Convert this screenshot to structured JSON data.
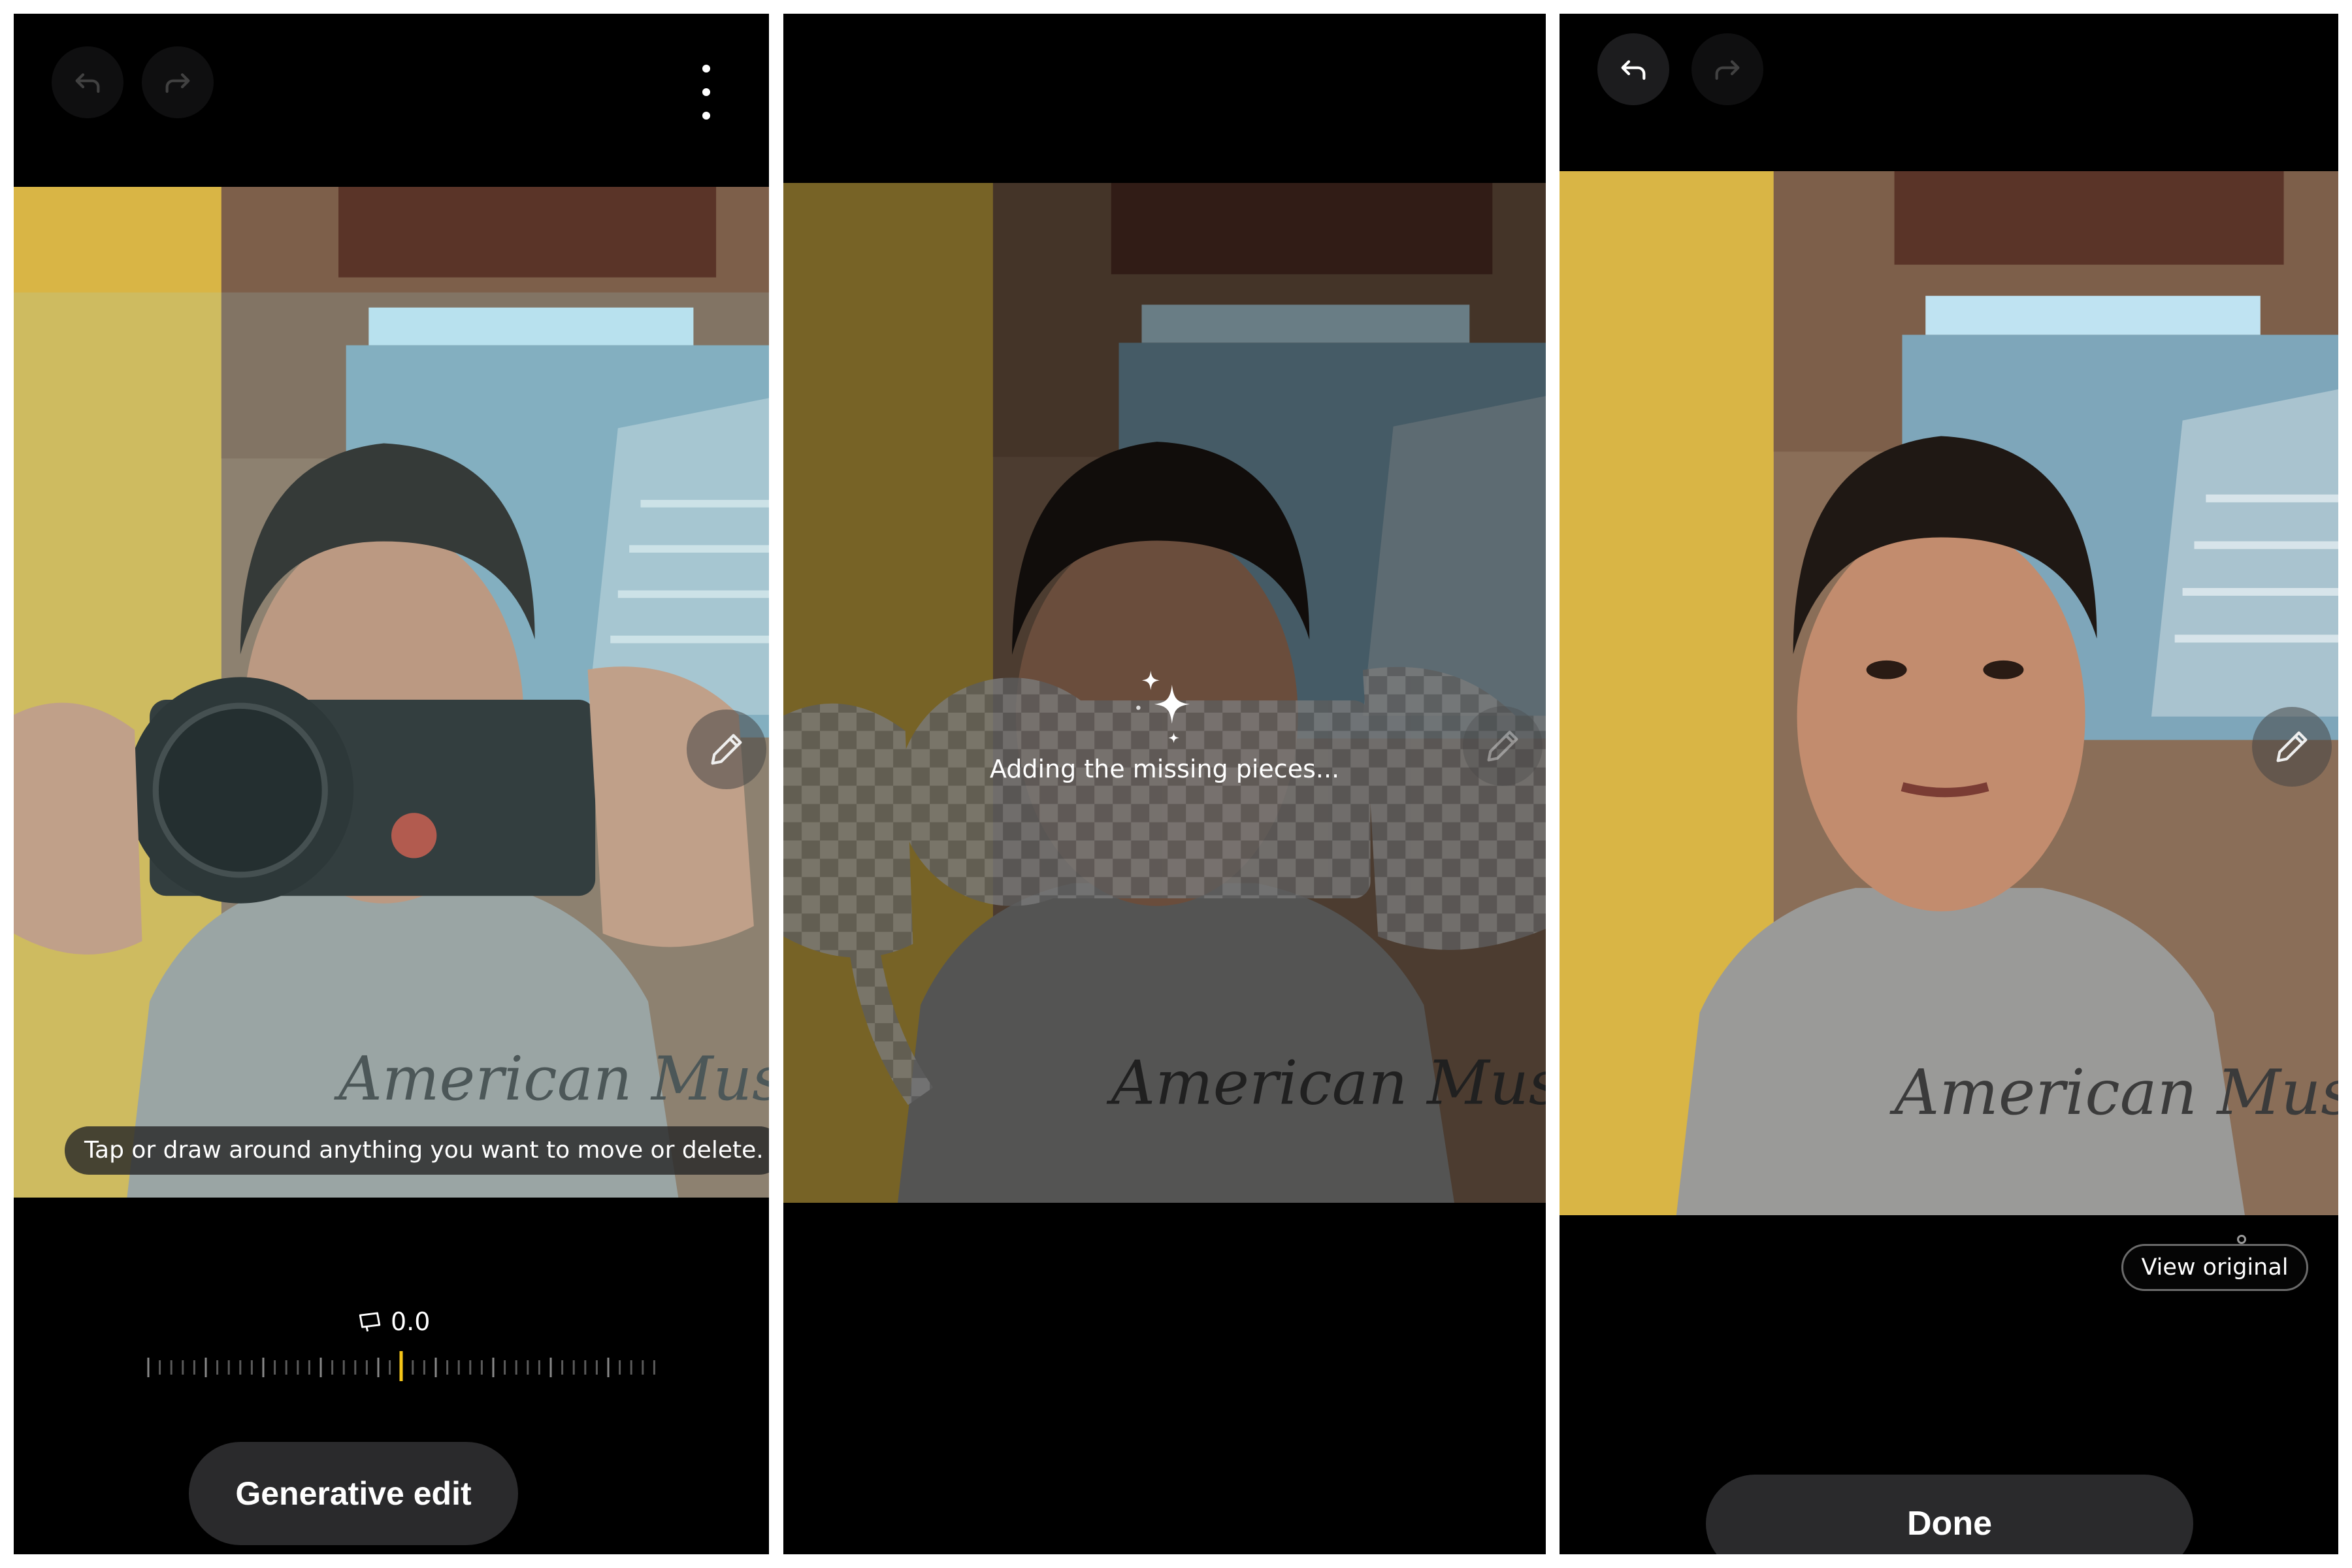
{
  "panel1": {
    "hint": "Tap or draw around anything you want to move or delete.",
    "dial_value": "0.0",
    "primary_button": "Generative edit"
  },
  "panel2": {
    "status": "Adding the missing pieces..."
  },
  "panel3": {
    "view_original": "View original",
    "primary_button": "Done"
  },
  "icons": {
    "undo": "undo-icon",
    "redo": "redo-icon",
    "more": "more-vertical-icon",
    "pen": "pen-icon",
    "sparkle": "sparkle-icon",
    "tilt": "tilt-icon"
  },
  "colors": {
    "background": "#000000",
    "button": "#2a2a2c",
    "dial_indicator": "#f5c518",
    "hint_pill": "#282828"
  }
}
